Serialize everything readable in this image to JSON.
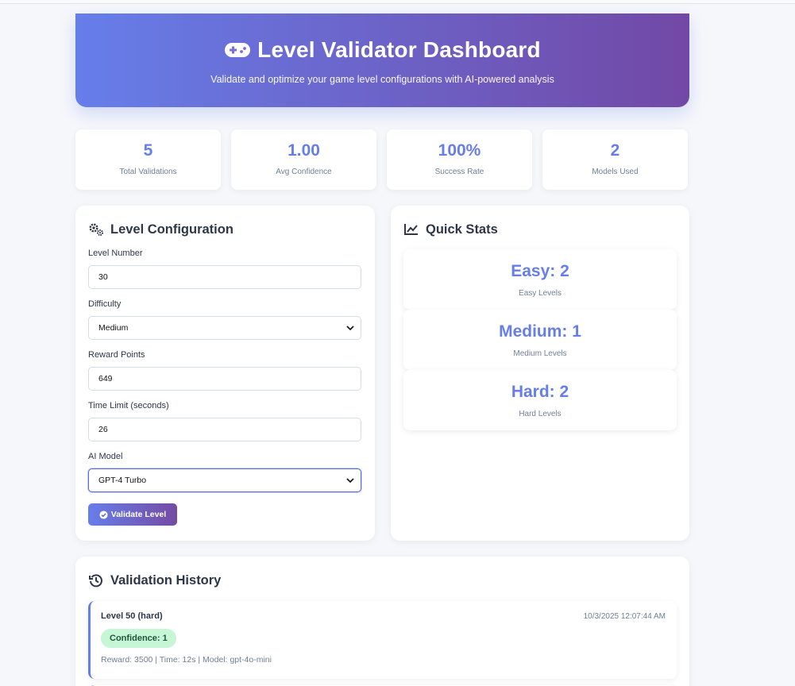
{
  "header": {
    "title": "Level Validator Dashboard",
    "subtitle": "Validate and optimize your game level configurations with AI-powered analysis",
    "icon": "gamepad-icon"
  },
  "stats": [
    {
      "value": "5",
      "label": "Total Validations"
    },
    {
      "value": "1.00",
      "label": "Avg Confidence"
    },
    {
      "value": "100%",
      "label": "Success Rate"
    },
    {
      "value": "2",
      "label": "Models Used"
    }
  ],
  "config": {
    "title": "Level Configuration",
    "icon": "cogs-icon",
    "level_number": {
      "label": "Level Number",
      "value": "30"
    },
    "difficulty": {
      "label": "Difficulty",
      "value": "Medium"
    },
    "reward_points": {
      "label": "Reward Points",
      "value": "649"
    },
    "time_limit": {
      "label": "Time Limit (seconds)",
      "value": "26"
    },
    "ai_model": {
      "label": "AI Model",
      "value": "GPT-4 Turbo"
    },
    "validate_label": "Validate Level"
  },
  "quick_stats": {
    "title": "Quick Stats",
    "icon": "chart-line-icon",
    "items": [
      {
        "value": "Easy: 2",
        "label": "Easy Levels"
      },
      {
        "value": "Medium: 1",
        "label": "Medium Levels"
      },
      {
        "value": "Hard: 2",
        "label": "Hard Levels"
      }
    ]
  },
  "history": {
    "title": "Validation History",
    "icon": "history-icon",
    "items": [
      {
        "title": "Level 50 (hard)",
        "time": "10/3/2025 12:07:44 AM",
        "badge": "Confidence: 1",
        "meta": "Reward: 3500 | Time: 12s | Model: gpt-4o-mini"
      }
    ]
  },
  "colors": {
    "accent": "#667eea",
    "accent_end": "#764ba2",
    "badge_bg": "#c6f6d5",
    "badge_text": "#22543d"
  }
}
